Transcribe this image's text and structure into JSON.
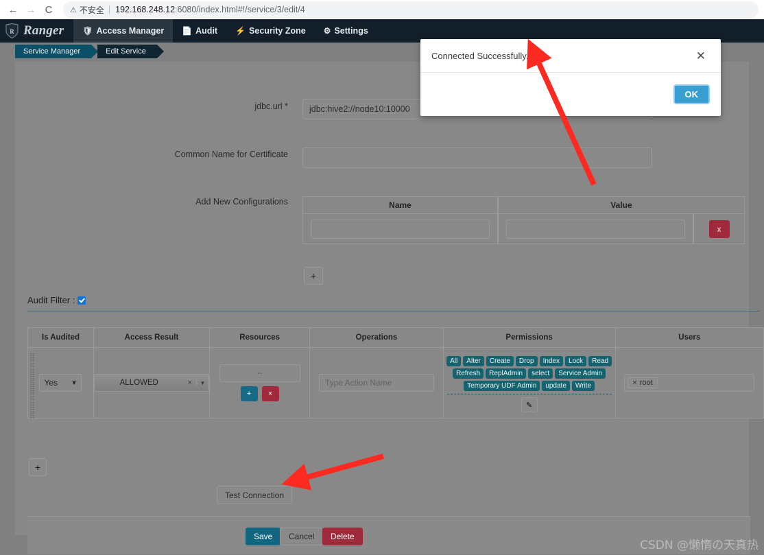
{
  "browser": {
    "back_icon": "back-arrow-icon",
    "forward_icon": "forward-arrow-icon",
    "reload_icon": "reload-icon",
    "security_icon": "not-secure-warning-icon",
    "security_label": "不安全",
    "url_host": "192.168.248.12",
    "url_rest": ":6080/index.html#!/service/3/edit/4"
  },
  "topnav": {
    "brand": "Ranger",
    "items": [
      {
        "label": "Access Manager",
        "icon": "shield-icon",
        "active": true
      },
      {
        "label": "Audit",
        "icon": "file-icon",
        "active": false
      },
      {
        "label": "Security Zone",
        "icon": "bolt-icon",
        "active": false
      },
      {
        "label": "Settings",
        "icon": "gear-icon",
        "active": false
      }
    ]
  },
  "breadcrumb": {
    "items": [
      "Service Manager",
      "Edit Service"
    ]
  },
  "form": {
    "jdbc_url_label": "jdbc.url *",
    "jdbc_url_value": "jdbc:hive2://node10:10000",
    "common_name_label": "Common Name for Certificate",
    "common_name_value": "",
    "add_new_config_label": "Add New Configurations",
    "config_table": {
      "headers": [
        "Name",
        "Value"
      ],
      "rows": [
        {
          "name": "",
          "value": ""
        }
      ],
      "remove_label": "x"
    },
    "add_config_button": "+"
  },
  "audit_filter": {
    "label": "Audit Filter :",
    "checked": true,
    "headers": [
      "Is Audited",
      "Access Result",
      "Resources",
      "Operations",
      "Permissions",
      "Users"
    ],
    "row": {
      "is_audited": "Yes",
      "access_result": "ALLOWED",
      "access_result_clear": "×",
      "resources_value": "--",
      "resources_add": "+",
      "resources_remove": "×",
      "operations_placeholder": "Type Action Name",
      "operations_value": "",
      "permissions": [
        "All",
        "Alter",
        "Create",
        "Drop",
        "Index",
        "Lock",
        "Read",
        "Refresh",
        "ReplAdmin",
        "select",
        "Service Admin",
        "Temporary UDF Admin",
        "update",
        "Write"
      ],
      "permissions_edit_icon": "pencil-icon",
      "users": [
        "root"
      ],
      "user_remove": "×"
    },
    "add_row_button": "+"
  },
  "actions": {
    "test_connection": "Test Connection",
    "save": "Save",
    "cancel": "Cancel",
    "delete": "Delete"
  },
  "modal": {
    "message": "Connected Successfully.",
    "close_icon": "close-icon",
    "ok": "OK"
  },
  "watermark": "CSDN @懒惰の天真热",
  "colors": {
    "navbar": "#121e29",
    "accent_teal": "#15636f",
    "danger_red": "#a02a3c",
    "primary_blue": "#3a9fd0",
    "backdrop": "#808080",
    "arrow_red": "#fc2a21"
  }
}
